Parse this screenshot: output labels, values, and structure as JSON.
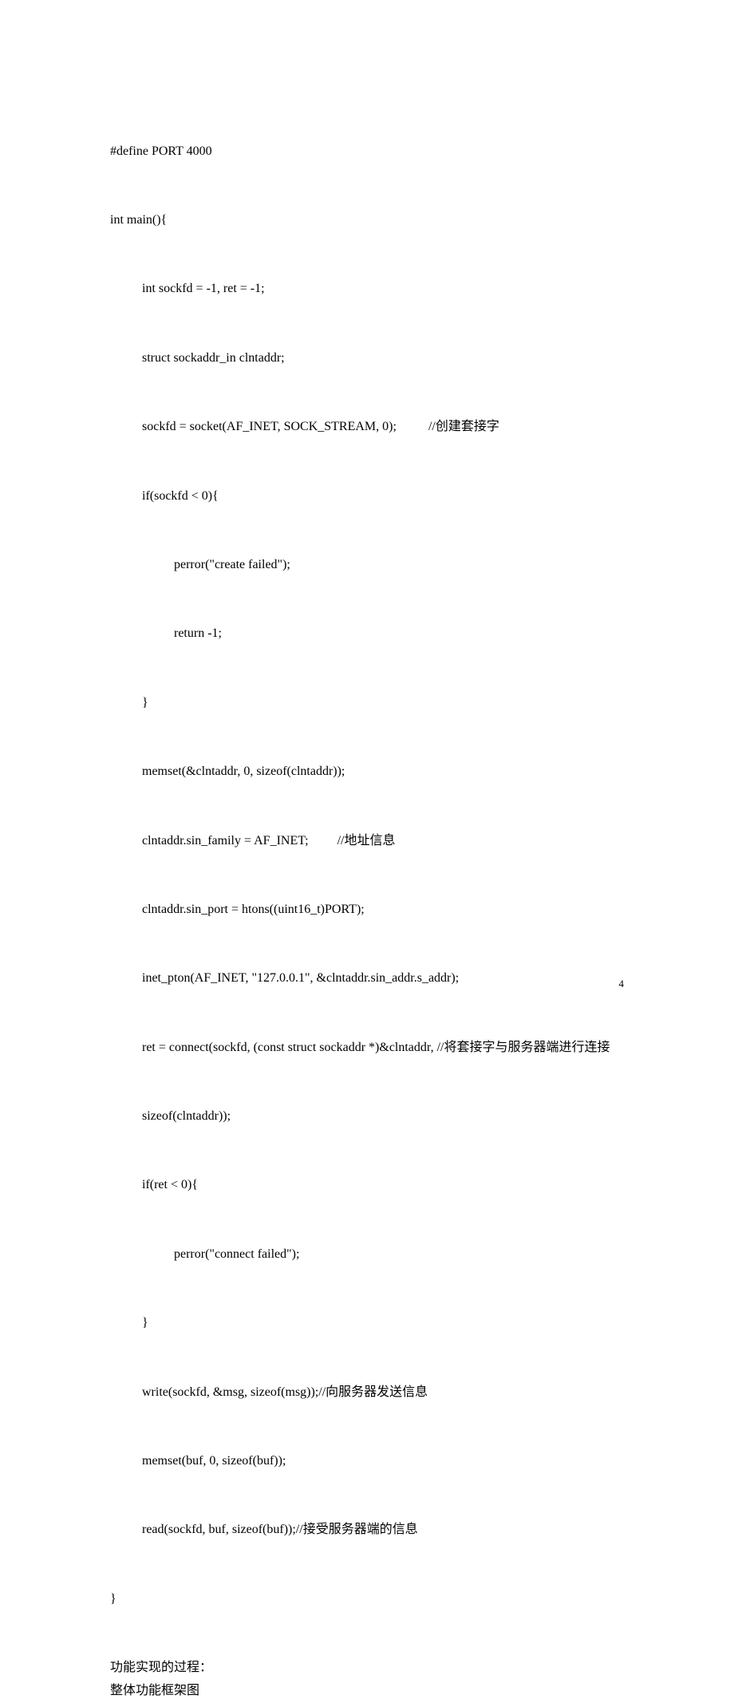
{
  "code": {
    "line1": "#define PORT 4000",
    "line2": "int main(){",
    "line3": "int sockfd = -1, ret = -1;",
    "line4": "struct sockaddr_in clntaddr;",
    "line5a": "sockfd = socket(AF_INET, SOCK_STREAM, 0);",
    "line5b": "//创建套接字",
    "line6": "if(sockfd < 0){",
    "line7": "perror(\"create failed\");",
    "line8": "return -1;",
    "line9": "}",
    "line10": "memset(&clntaddr, 0, sizeof(clntaddr));",
    "line11a": "clntaddr.sin_family = AF_INET;",
    "line11b": "//地址信息",
    "line12": "clntaddr.sin_port = htons((uint16_t)PORT);",
    "line13": "inet_pton(AF_INET, \"127.0.0.1\", &clntaddr.sin_addr.s_addr);",
    "line14": "ret = connect(sockfd, (const struct sockaddr *)&clntaddr, //将套接字与服务器端进行连接",
    "line15": "sizeof(clntaddr));",
    "line16": "if(ret < 0){",
    "line17": "perror(\"connect failed\");",
    "line18": "}",
    "line19": "write(sockfd, &msg, sizeof(msg));//向服务器发送信息",
    "line20": "memset(buf, 0, sizeof(buf));",
    "line21": "read(sockfd, buf, sizeof(buf));//接受服务器端的信息",
    "line22": "}"
  },
  "footer": {
    "line1": "功能实现的过程：",
    "line2": "整体功能框架图"
  },
  "pageNumber": "4"
}
